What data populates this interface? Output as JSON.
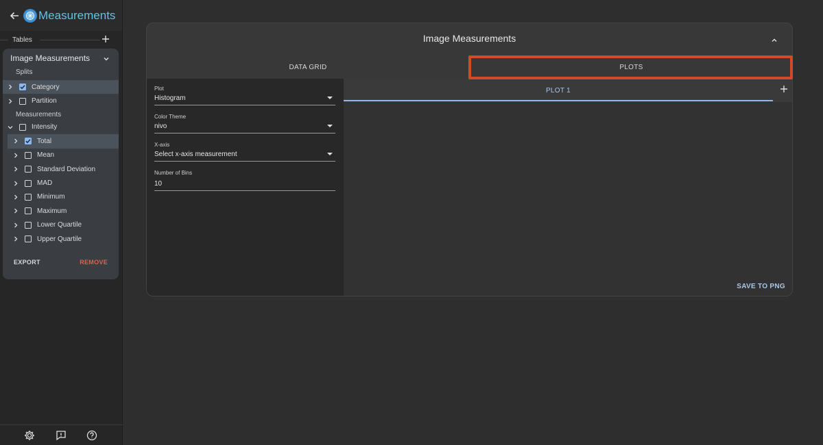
{
  "app": {
    "title": "Measurements"
  },
  "sidebar": {
    "tables_label": "Tables",
    "table": {
      "title": "Image Measurements",
      "splits_label": "Splits",
      "splits": [
        {
          "label": "Category",
          "checked": true
        },
        {
          "label": "Partition",
          "checked": false
        }
      ],
      "measurements_label": "Measurements",
      "measurement_group": {
        "label": "Intensity",
        "checked": false
      },
      "measurements": [
        {
          "label": "Total",
          "checked": true
        },
        {
          "label": "Mean",
          "checked": false
        },
        {
          "label": "Standard Deviation",
          "checked": false
        },
        {
          "label": "MAD",
          "checked": false
        },
        {
          "label": "Minimum",
          "checked": false
        },
        {
          "label": "Maximum",
          "checked": false
        },
        {
          "label": "Lower Quartile",
          "checked": false
        },
        {
          "label": "Upper Quartile",
          "checked": false
        }
      ],
      "export_label": "EXPORT",
      "remove_label": "REMOVE"
    },
    "footer_icons": [
      "gear-icon",
      "feedback-icon",
      "help-icon"
    ]
  },
  "panel": {
    "title": "Image Measurements",
    "tabs": [
      {
        "label": "DATA GRID"
      },
      {
        "label": "PLOTS"
      }
    ],
    "controls": {
      "plot": {
        "label": "Plot",
        "value": "Histogram"
      },
      "color_theme": {
        "label": "Color Theme",
        "value": "nivo"
      },
      "x_axis": {
        "label": "X-axis",
        "value": "Select x-axis measurement"
      },
      "bins": {
        "label": "Number of Bins",
        "value": "10"
      }
    },
    "plot_tabs": [
      {
        "label": "PLOT 1"
      }
    ],
    "save_label": "SAVE TO PNG"
  },
  "colors": {
    "accent": "#8fb8e8",
    "brand": "#5fc3e8",
    "danger": "#d9654b",
    "highlight": "#d14a2a"
  }
}
